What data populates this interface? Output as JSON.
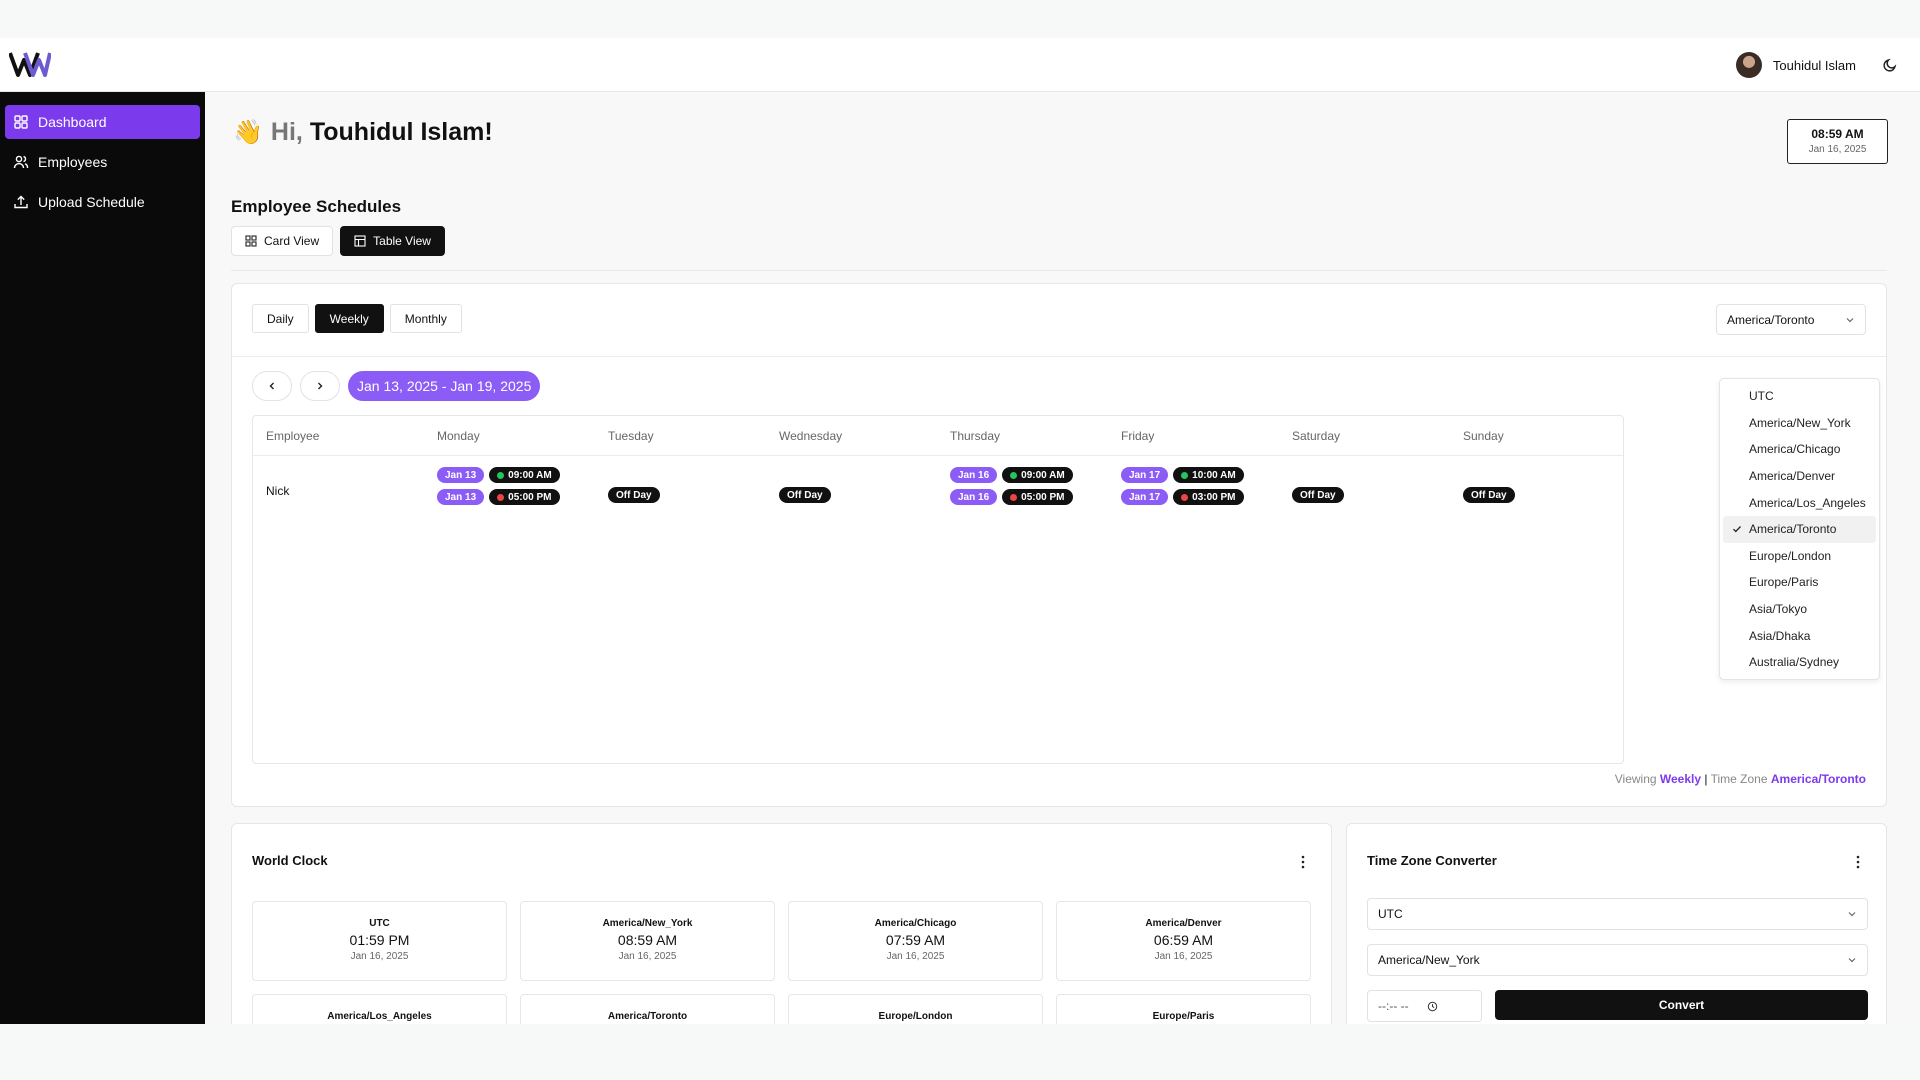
{
  "user": {
    "name": "Touhidul Islam"
  },
  "sidebar": {
    "items": [
      {
        "label": "Dashboard",
        "icon": "dashboard-icon"
      },
      {
        "label": "Employees",
        "icon": "users-icon"
      },
      {
        "label": "Upload Schedule",
        "icon": "upload-icon"
      }
    ]
  },
  "greeting": {
    "emoji": "👋",
    "hi": "Hi,",
    "name": "Touhidul Islam!"
  },
  "current_time": {
    "time": "08:59 AM",
    "date": "Jan 16, 2025"
  },
  "schedules": {
    "title": "Employee Schedules",
    "view_tabs": [
      "Card View",
      "Table View"
    ],
    "active_view": "Table View",
    "period_tabs": [
      "Daily",
      "Weekly",
      "Monthly"
    ],
    "active_period": "Weekly",
    "timezone": "America/Toronto",
    "date_range": "Jan 13, 2025 - Jan 19, 2025",
    "columns": [
      "Employee",
      "Monday",
      "Tuesday",
      "Wednesday",
      "Thursday",
      "Friday",
      "Saturday",
      "Sunday"
    ],
    "rows": [
      {
        "employee": "Nick",
        "monday": {
          "start_date": "Jan 13",
          "start_time": "09:00 AM",
          "end_date": "Jan 13",
          "end_time": "05:00 PM"
        },
        "tuesday": "Off Day",
        "wednesday": "Off Day",
        "thursday": {
          "start_date": "Jan 16",
          "start_time": "09:00 AM",
          "end_date": "Jan 16",
          "end_time": "05:00 PM"
        },
        "friday": {
          "start_date": "Jan 17",
          "start_time": "10:00 AM",
          "end_date": "Jan 17",
          "end_time": "03:00 PM"
        },
        "saturday": "Off Day",
        "sunday": "Off Day"
      }
    ],
    "footer": {
      "viewing_label": "Viewing",
      "viewing_value": "Weekly",
      "separator": "|",
      "tz_label": "Time Zone",
      "tz_value": "America/Toronto"
    }
  },
  "timezone_options": [
    "UTC",
    "America/New_York",
    "America/Chicago",
    "America/Denver",
    "America/Los_Angeles",
    "America/Toronto",
    "Europe/London",
    "Europe/Paris",
    "Asia/Tokyo",
    "Asia/Dhaka",
    "Australia/Sydney"
  ],
  "world_clock": {
    "title": "World Clock",
    "clocks": [
      {
        "zone": "UTC",
        "time": "01:59 PM",
        "date": "Jan 16, 2025"
      },
      {
        "zone": "America/New_York",
        "time": "08:59 AM",
        "date": "Jan 16, 2025"
      },
      {
        "zone": "America/Chicago",
        "time": "07:59 AM",
        "date": "Jan 16, 2025"
      },
      {
        "zone": "America/Denver",
        "time": "06:59 AM",
        "date": "Jan 16, 2025"
      },
      {
        "zone": "America/Los_Angeles",
        "time": "",
        "date": ""
      },
      {
        "zone": "America/Toronto",
        "time": "",
        "date": ""
      },
      {
        "zone": "Europe/London",
        "time": "",
        "date": ""
      },
      {
        "zone": "Europe/Paris",
        "time": "",
        "date": ""
      }
    ]
  },
  "converter": {
    "title": "Time Zone Converter",
    "from": "UTC",
    "to": "America/New_York",
    "time_placeholder": "--:-- --",
    "button": "Convert"
  },
  "colors": {
    "accent": "#7c3aed",
    "pill_purple": "#8b5cf6",
    "sidebar_bg": "#0a0a0a",
    "start_dot": "#22c55e",
    "end_dot": "#ef4444"
  }
}
